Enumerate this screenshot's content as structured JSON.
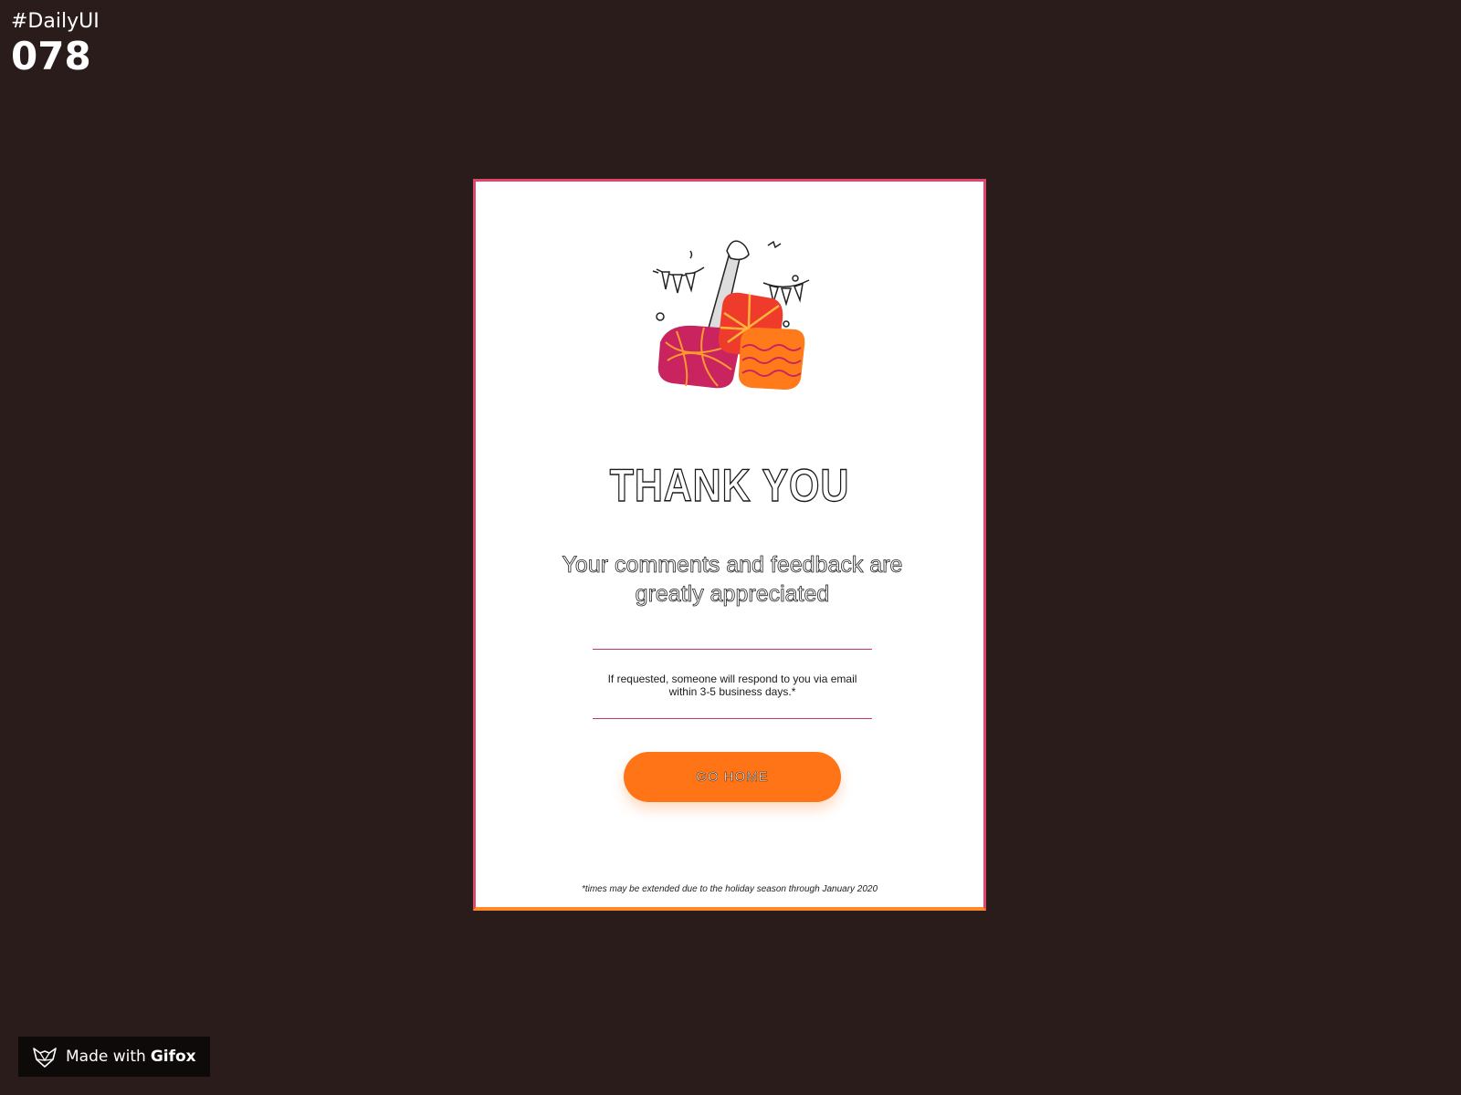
{
  "overlay": {
    "hashtag": "#DailyUI",
    "number": "078"
  },
  "card": {
    "title": "THANK YOU",
    "subtitle": "Your comments and feedback are greatly appreciated",
    "notice": "If requested, someone will respond to you via email within 3-5 business days.*",
    "button_label": "GO HOME",
    "footnote": "*times may be extended due to the holiday season through January 2020",
    "illustration_icon": "celebration-gifts-icon"
  },
  "badge": {
    "prefix": "Made with",
    "brand": "Gifox",
    "icon": "fox-logo-icon"
  },
  "colors": {
    "background": "#2b1c1c",
    "card_border": "#e0456a",
    "card_border_bottom": "#ff8a2a",
    "button": "#ff7416",
    "divider": "#c8346c",
    "gift_magenta": "#c9245f",
    "gift_red": "#ef3b2c",
    "gift_orange": "#ff7a1a"
  }
}
